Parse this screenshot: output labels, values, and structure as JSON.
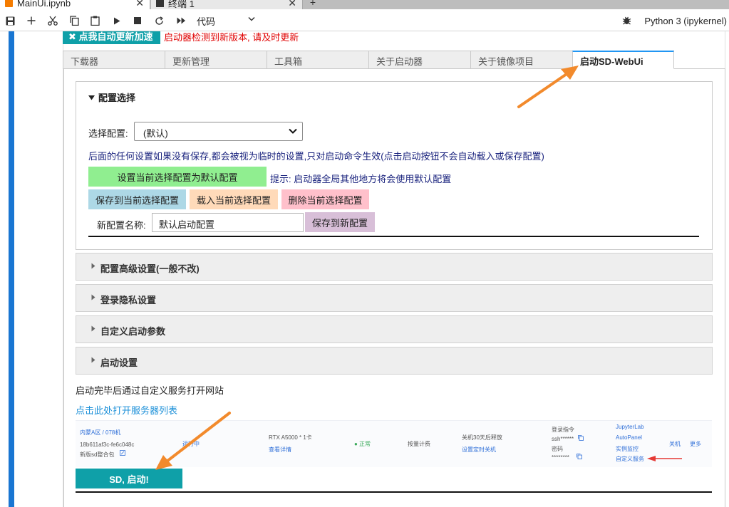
{
  "tabs": [
    {
      "label": "MainUi.ipynb",
      "close": "✕"
    },
    {
      "label": "终端 1",
      "close": "✕"
    }
  ],
  "tab_add": "+",
  "toolbar": {
    "cell_type": "代码",
    "kernel": "Python 3 (ipykernel)"
  },
  "update_button": "✖ 点我自动更新加速",
  "update_message": "启动器检测到新版本, 请及时更新",
  "main_tabs": [
    "下载器",
    "更新管理",
    "工具箱",
    "关于启动器",
    "关于镜像项目",
    "启动SD-WebUi"
  ],
  "config": {
    "title": "配置选择",
    "select_label": "选择配置:",
    "select_value": "(默认)",
    "note": "后面的任何设置如果没有保存,都会被视为临时的设置,只对启动命令生效(点击启动按钮不会自动载入或保存配置)",
    "set_default": "设置当前选择配置为默认配置",
    "hint": "提示: 启动器全局其他地方将会使用默认配置",
    "save_current": "保存到当前选择配置",
    "load_current": "载入当前选择配置",
    "delete_current": "删除当前选择配置",
    "new_name_label": "新配置名称:",
    "new_name_value": "默认启动配置",
    "save_new": "保存到新配置"
  },
  "accordions": [
    "配置高级设置(一般不改)",
    "登录隐私设置",
    "自定义启动参数",
    "启动设置"
  ],
  "after_text": "启动完毕后通过自定义服务打开网站",
  "server_link": "点击此处打开服务器列表",
  "server_row": {
    "region": "内蒙A区 / 078机",
    "id": "18b611af3c-fe6c048c",
    "image": "新版sd整合包",
    "status": "运行中",
    "gpu": "RTX A5000 * 1卡",
    "gpu_link": "查看详情",
    "health": "● 正常",
    "billing": "按量计费",
    "shutdown": "关机30天后释放",
    "shutdown_link": "设置定时关机",
    "login_cmd": "登录指令",
    "ssh": "ssh******",
    "password_label": "密码",
    "password": "********",
    "jupyter": "JupyterLab",
    "autopanel": "AutoPanel",
    "monitor": "实例监控",
    "custom_service": "自定义服务",
    "power_off": "关机",
    "more": "更多"
  },
  "sd_button": "SD, 启动!",
  "colors": {
    "accent_teal": "#0fa0a8",
    "left_bar": "#1976d2",
    "arrow": "#f28a2c",
    "red_arrow": "#e53935",
    "warning_text": "#e00000",
    "btn_green": "#90ee90",
    "btn_blue": "#add8e6",
    "btn_orange": "#ffdab9",
    "btn_pink": "#ffc0cb",
    "btn_purple": "#d8bfd8"
  }
}
